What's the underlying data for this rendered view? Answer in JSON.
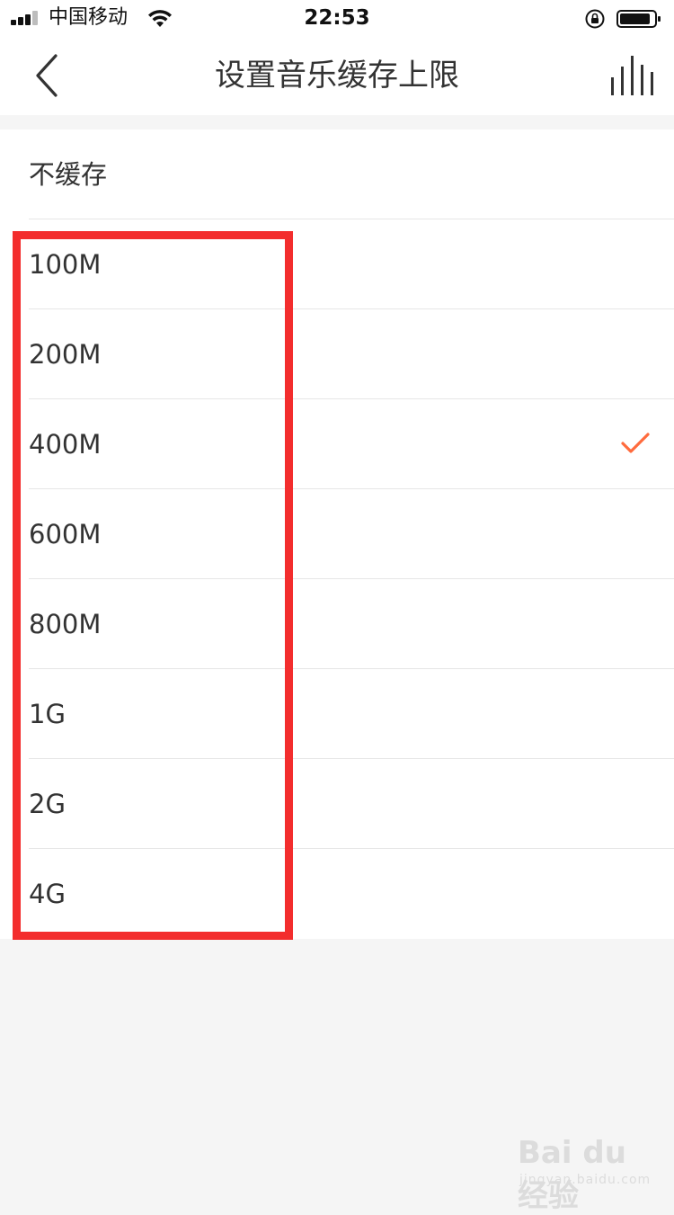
{
  "status_bar": {
    "carrier": "中国移动",
    "time": "22:53"
  },
  "nav": {
    "title": "设置音乐缓存上限"
  },
  "options": [
    {
      "label": "不缓存",
      "selected": false
    },
    {
      "label": "100M",
      "selected": false
    },
    {
      "label": "200M",
      "selected": false
    },
    {
      "label": "400M",
      "selected": true
    },
    {
      "label": "600M",
      "selected": false
    },
    {
      "label": "800M",
      "selected": false
    },
    {
      "label": "1G",
      "selected": false
    },
    {
      "label": "2G",
      "selected": false
    },
    {
      "label": "4G",
      "selected": false
    }
  ],
  "colors": {
    "check_accent": "#ff6b3d",
    "highlight": "#f32d2d",
    "background": "#f5f5f5"
  },
  "icons": {
    "back": "chevron-left-icon",
    "audio_bars": "equalizer-bars-icon",
    "check": "checkmark-icon"
  },
  "watermark": {
    "brand": "Bai du 经验",
    "site": "jingyan.baidu.com"
  }
}
